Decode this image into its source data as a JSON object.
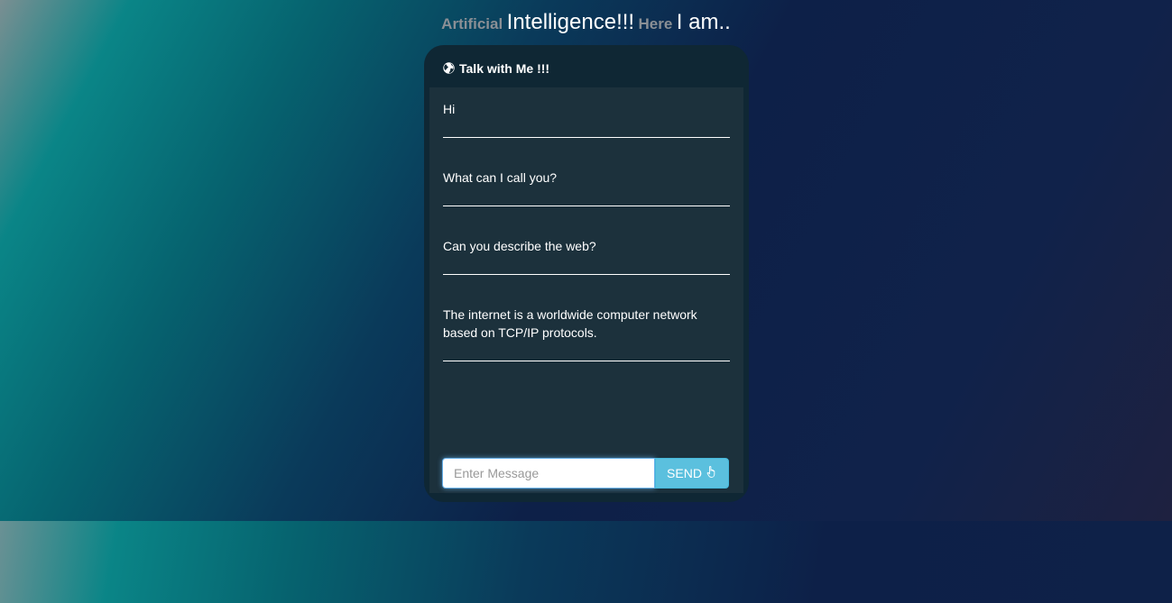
{
  "page": {
    "heading": {
      "word1": "Artificial",
      "word2": "Intelligence!!!",
      "word3": "Here",
      "word4": "I am.."
    }
  },
  "chat": {
    "header_title": "Talk with Me !!!",
    "header_icon": "globe-icon",
    "messages": [
      "Hi",
      "What can I call you?",
      "Can you describe the web?",
      "The internet is a worldwide computer network based on TCP/IP protocols."
    ],
    "input": {
      "value": "",
      "placeholder": "Enter Message"
    },
    "send_button": {
      "label": "SEND",
      "icon": "hand-pointer-icon"
    }
  },
  "colors": {
    "panel": "#0f2734",
    "body": "#1c313c",
    "button": "#5bc0de",
    "heading_muted": "#8a8f95"
  }
}
